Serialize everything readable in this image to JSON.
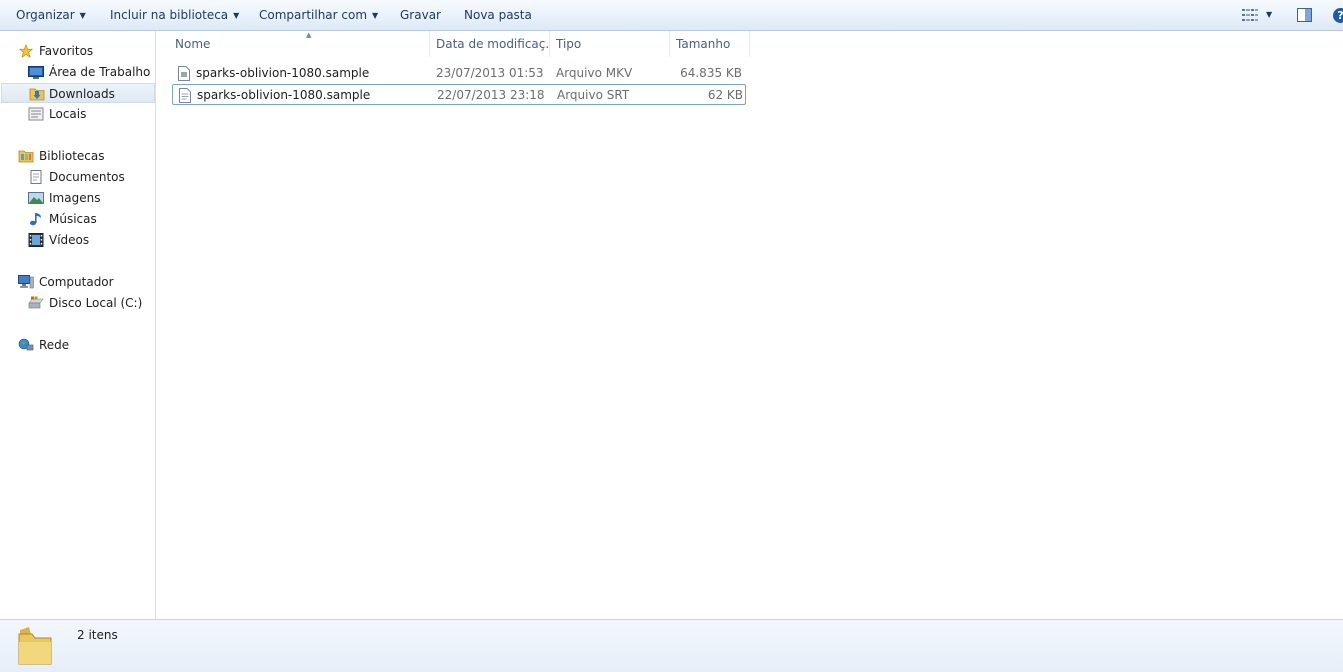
{
  "toolbar": {
    "organize": "Organizar",
    "include_library": "Incluir na biblioteca",
    "share_with": "Compartilhar com",
    "burn": "Gravar",
    "new_folder": "Nova pasta"
  },
  "nav": {
    "favorites": {
      "label": "Favoritos",
      "items": [
        "Área de Trabalho",
        "Downloads",
        "Locais"
      ]
    },
    "libraries": {
      "label": "Bibliotecas",
      "items": [
        "Documentos",
        "Imagens",
        "Músicas",
        "Vídeos"
      ]
    },
    "computer": {
      "label": "Computador",
      "items": [
        "Disco Local (C:)"
      ]
    },
    "network": {
      "label": "Rede"
    }
  },
  "columns": {
    "name": "Nome",
    "date": "Data de modificaç...",
    "type": "Tipo",
    "size": "Tamanho"
  },
  "files": [
    {
      "name": "sparks-oblivion-1080.sample",
      "date": "23/07/2013 01:53",
      "type": "Arquivo MKV",
      "size": "64.835 KB"
    },
    {
      "name": "sparks-oblivion-1080.sample",
      "date": "22/07/2013 23:18",
      "type": "Arquivo SRT",
      "size": "62 KB"
    }
  ],
  "status": {
    "item_count": "2 itens"
  },
  "icons": {
    "star": "star-icon",
    "desktop": "desktop-icon",
    "downloads": "downloads-folder-icon",
    "places": "recent-places-icon",
    "libraries": "libraries-icon",
    "documents": "documents-icon",
    "pictures": "pictures-icon",
    "music": "music-icon",
    "videos": "videos-icon",
    "computer": "computer-icon",
    "drive": "local-disk-icon",
    "network": "network-icon"
  },
  "colors": {
    "toolbar_text": "#1e395b",
    "selection_border": "#7da2ce",
    "secondary_text": "#6d6d6d"
  }
}
